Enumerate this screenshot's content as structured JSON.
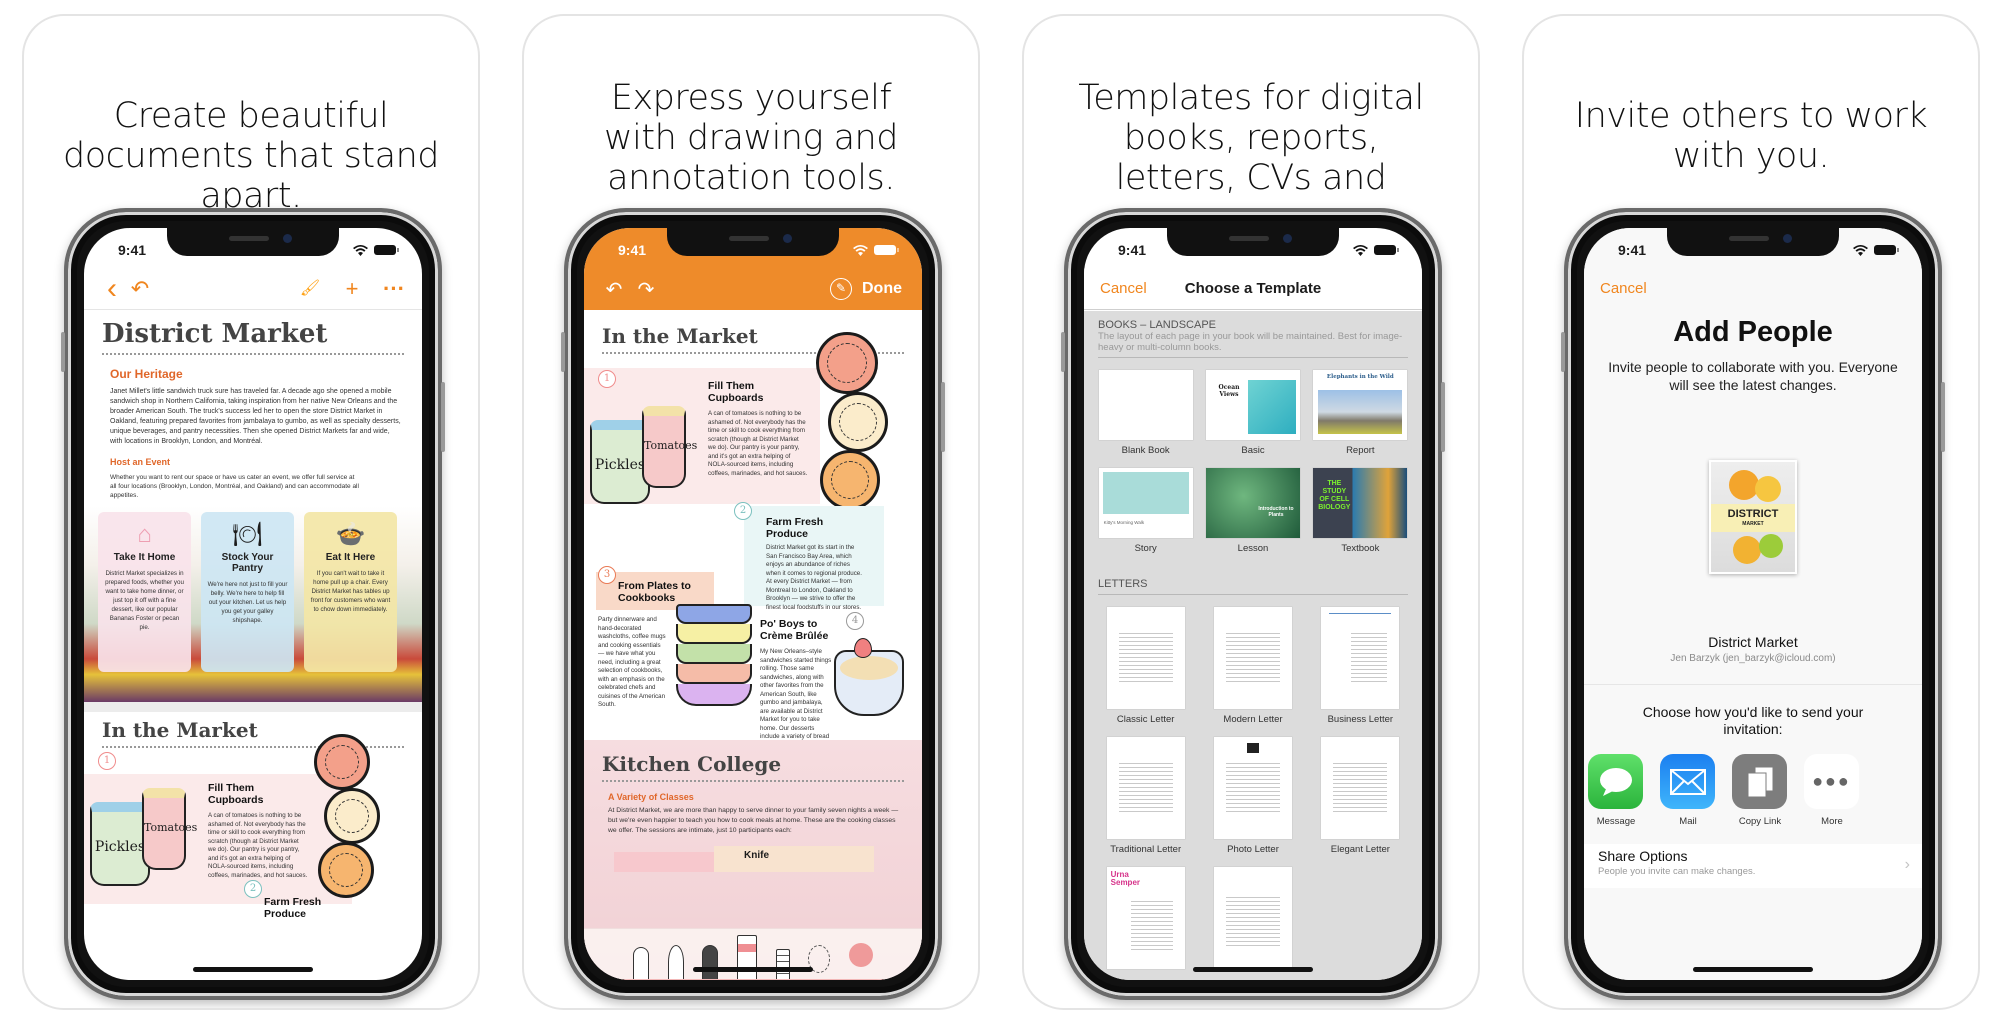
{
  "cards": [
    {
      "caption": "Create beautiful documents that stand apart.",
      "status_time": "9:41",
      "toolbar": {
        "back_icon": "‹",
        "undo_icon": "↶",
        "format_icon": "🖌",
        "add_icon": "+",
        "more_icon": "···"
      },
      "doc": {
        "title": "District Market",
        "heritage_heading": "Our Heritage",
        "heritage_body": "Janet Millet's little sandwich truck sure has traveled far. A decade ago she opened a mobile sandwich shop in Northern California, taking inspiration from her native New Orleans and the broader American South. The truck's success led her to open the store District Market in Oakland, featuring prepared favorites from jambalaya to gumbo, as well as specialty desserts, unique beverages, and pantry necessities. Then she opened District Markets far and wide, with locations in Brooklyn, London, and Montréal.",
        "event_heading": "Host an Event",
        "event_body": "Whether you want to rent our space or have us cater an event, we offer full service at all four locations (Brooklyn, London, Montréal, and Oakland) and can accommodate all appetites.",
        "feature_cards": [
          {
            "icon": "⌂",
            "title": "Take It Home",
            "body": "District Market specializes in prepared foods, whether you want to take home dinner, or just top it off with a fine dessert, like our popular Bananas Foster or pecan pie.",
            "bg": "#f9e3ea",
            "icon_color": "#ee9fb2"
          },
          {
            "icon": "🍽",
            "title": "Stock Your Pantry",
            "body": "We're here not just to fill your belly. We're here to help fill out your kitchen. Let us help you get your galley shipshape.",
            "bg": "#cde6f3",
            "icon_color": "#6d8fd6"
          },
          {
            "icon": "🍲",
            "title": "Eat It Here",
            "body": "If you can't wait to take it home pull up a chair. Every District Market has tables up front for customers who want to chow down immediately.",
            "bg": "#f3e6a6",
            "icon_color": "#f0b43a"
          }
        ],
        "market_title": "In the Market",
        "item1_num": "1",
        "item1_title": "Fill Them Cupboards",
        "item1_body": "A can of tomatoes is nothing to be ashamed of. Not everybody has the time or skill to cook everything from scratch (though at District Market we do). Our pantry is your pantry, and it's got an extra helping of NOLA-sourced items, including coffees, marinades, and hot sauces.",
        "item2_num": "2",
        "item2_title": "Farm Fresh Produce",
        "jar1_label": "Pickles",
        "jar2_label": "Tomatoes"
      }
    },
    {
      "caption": "Express yourself with drawing and annotation tools.",
      "status_time": "9:41",
      "toolbar": {
        "undo_icon": "↶",
        "redo_icon": "↷",
        "pencil_icon": "✎",
        "done_label": "Done"
      },
      "doc": {
        "market_title": "In the Market",
        "items": [
          {
            "num": "1",
            "title": "Fill Them Cupboards",
            "body": "A can of tomatoes is nothing to be ashamed of. Not everybody has the time or skill to cook everything from scratch (though at District Market we do). Our pantry is your pantry, and it's got an extra helping of NOLA-sourced items, including coffees, marinades, and hot sauces."
          },
          {
            "num": "2",
            "title": "Farm Fresh Produce",
            "body": "District Market got its start in the San Francisco Bay Area, which enjoys an abundance of riches when it comes to regional produce. At every District Market — from Montreal to London, Oakland to Brooklyn — we strive to offer the finest local foodstuffs in our stores."
          },
          {
            "num": "3",
            "title": "From Plates to Cookbooks",
            "body": "Party dinnerware and hand-decorated washcloths, coffee mugs and cooking essentials — we have what you need, including a great selection of cookbooks, with an emphasis on the celebrated chefs and cuisines of the American South."
          },
          {
            "num": "4",
            "title": "Po' Boys to Crème Brûlée",
            "body": "My New Orleans–style sandwiches started things rolling. Those same sandwiches, along with other favorites from the American South, like gumbo and jambalaya, are available at District Market for you to take home. Our desserts include a variety of bread puddings and expert crème brûlée."
          }
        ],
        "jar1_label": "Pickles",
        "jar2_label": "Tomatoes",
        "kitchen_title": "Kitchen College",
        "classes_heading": "A Variety of Classes",
        "classes_body": "At District Market, we are more than happy to serve dinner to your family seven nights a week — but we're even happier to teach you how to cook meals at home. These are the cooking classes we offer. The sessions are intimate, just 10 participants each:",
        "class_partial": "Knife"
      },
      "palette": {
        "tools": [
          "pen",
          "pencil",
          "marker",
          "crayon",
          "eraser",
          "lasso"
        ],
        "color": "#ef9a9a"
      }
    },
    {
      "caption": "Templates for digital books, reports, letters, CVs and more.",
      "status_time": "9:41",
      "nav": {
        "cancel": "Cancel",
        "title": "Choose a Template"
      },
      "books_section": {
        "title": "BOOKS – LANDSCAPE",
        "description": "The layout of each page in your book will be maintained. Best for image-heavy or multi-column books.",
        "templates": [
          {
            "label": "Blank Book",
            "thumb_text": ""
          },
          {
            "label": "Basic",
            "thumb_text": "Ocean Views"
          },
          {
            "label": "Report",
            "thumb_text": "Elephants in the Wild"
          },
          {
            "label": "Story",
            "thumb_text": "Kitty's Morning Walk"
          },
          {
            "label": "Lesson",
            "thumb_text": "Introduction to Plants"
          },
          {
            "label": "Textbook",
            "thumb_text": "THE STUDY OF CELL BIOLOGY"
          }
        ]
      },
      "letters_section": {
        "title": "LETTERS",
        "templates": [
          {
            "label": "Classic Letter"
          },
          {
            "label": "Modern Letter"
          },
          {
            "label": "Business Letter"
          },
          {
            "label": "Traditional Letter"
          },
          {
            "label": "Photo Letter"
          },
          {
            "label": "Elegant Letter"
          },
          {
            "label": "",
            "thumb_text": "Urna Semper"
          },
          {
            "label": ""
          }
        ]
      }
    },
    {
      "caption": "Invite others to work with you.",
      "status_time": "9:41",
      "cancel": "Cancel",
      "title": "Add People",
      "subtitle": "Invite people to collaborate with you. Everyone will see the latest changes.",
      "cover": {
        "title": "DISTRICT",
        "subtitle": "MARKET"
      },
      "document_name": "District Market",
      "owner": "Jen Barzyk (jen_barzyk@icloud.com)",
      "choose_label": "Choose how you'd like to send your invitation:",
      "share_targets": [
        {
          "label": "Message",
          "icon": "message-icon",
          "color": "#34c84a"
        },
        {
          "label": "Mail",
          "icon": "mail-icon",
          "color": "#2f8ef0"
        },
        {
          "label": "Copy Link",
          "icon": "copy-link-icon",
          "color": "#7d7d7d"
        },
        {
          "label": "More",
          "icon": "more-icon",
          "color": "#ffffff"
        }
      ],
      "share_options": {
        "title": "Share Options",
        "description": "People you invite can make changes."
      }
    }
  ],
  "colors": {
    "accent_orange": "#f0861f",
    "header_orange": "#ee8b2a",
    "heading_orange": "#e0672a"
  }
}
